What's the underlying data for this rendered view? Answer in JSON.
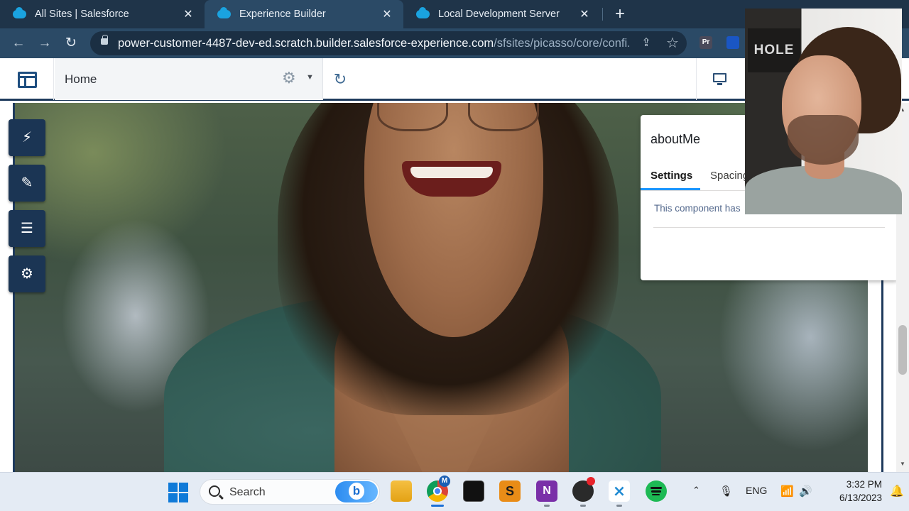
{
  "browser": {
    "tabs": [
      {
        "title": "All Sites | Salesforce",
        "close": "✕"
      },
      {
        "title": "Experience Builder",
        "close": "✕"
      },
      {
        "title": "Local Development Server",
        "close": "✕"
      }
    ],
    "new_tab": "+",
    "url_host": "power-customer-4487-dev-ed.scratch.builder.salesforce-experience.com",
    "url_path": "/sfsites/picasso/core/confi...",
    "extensions": [
      "Pr"
    ]
  },
  "builder": {
    "page_name": "Home",
    "side_tools": [
      "components-icon",
      "theme-brush-icon",
      "page-structure-icon",
      "settings-gear-icon"
    ]
  },
  "properties_panel": {
    "title": "aboutMe",
    "tabs": [
      "Settings",
      "Spacing"
    ],
    "message": "This component has"
  },
  "webcam": {
    "sign_text": "HOLE"
  },
  "taskbar": {
    "search_label": "Search",
    "language": "ENG",
    "time": "3:32 PM",
    "date": "6/13/2023",
    "chrome_badge": "M"
  },
  "colors": {
    "chrome_tabbar": "#1f3449",
    "chrome_toolbar": "#2b4a66",
    "builder_accent": "#1e3a5c",
    "active_tab_underline": "#1b96ff"
  }
}
